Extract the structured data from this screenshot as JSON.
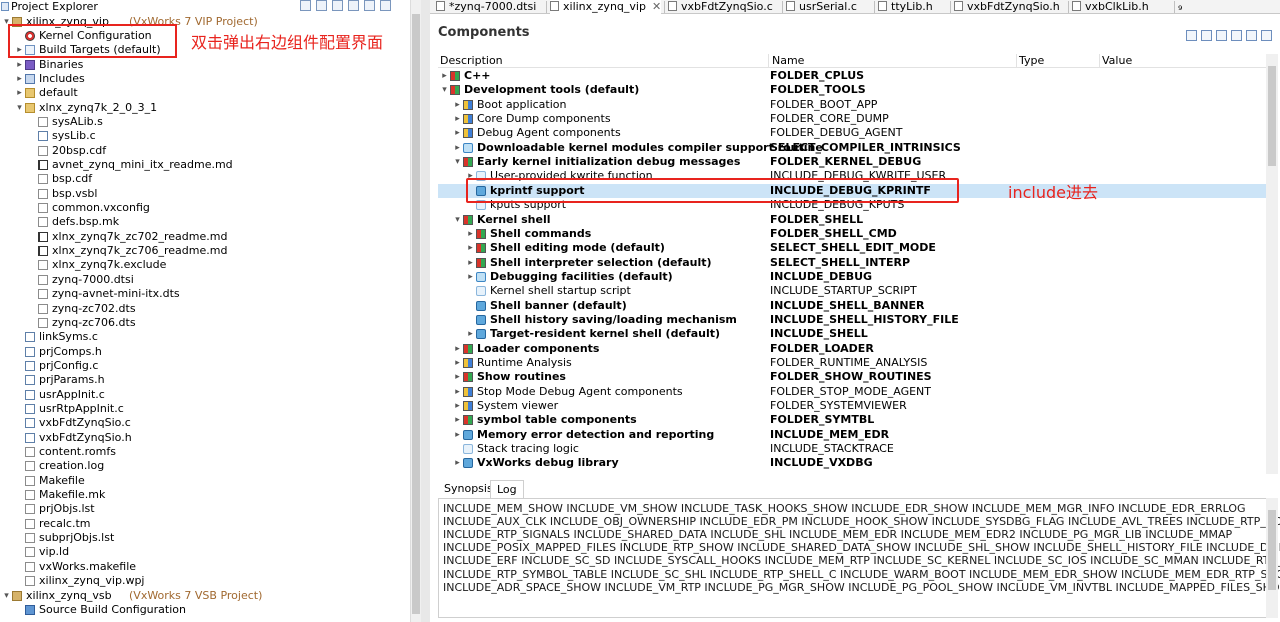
{
  "explorer": {
    "title": "Project Explorer",
    "tree": [
      {
        "label": "xilinx_zynq_vip",
        "decoration": "(VxWorks 7 VIP Project)",
        "icon": "project-icon",
        "level": 0,
        "twisty": "open"
      },
      {
        "label": "Kernel Configuration",
        "icon": "kernel-config-icon",
        "level": 1
      },
      {
        "label": "Build Targets (default)",
        "icon": "build-targets-icon",
        "level": 1,
        "twisty": "closed"
      },
      {
        "label": "Binaries",
        "icon": "binaries-icon",
        "level": 1,
        "twisty": "closed"
      },
      {
        "label": "Includes",
        "icon": "includes-icon",
        "level": 1,
        "twisty": "closed"
      },
      {
        "label": "default",
        "icon": "folder-icon",
        "level": 1,
        "twisty": "closed"
      },
      {
        "label": "xlnx_zynq7k_2_0_3_1",
        "icon": "folder-icon",
        "level": 1,
        "twisty": "open"
      },
      {
        "label": "sysALib.s",
        "icon": "file-icon",
        "level": 2
      },
      {
        "label": "sysLib.c",
        "icon": "c-file-icon",
        "level": 2
      },
      {
        "label": "20bsp.cdf",
        "icon": "file-icon",
        "level": 2
      },
      {
        "label": "avnet_zynq_mini_itx_readme.md",
        "icon": "markdown-icon",
        "level": 2
      },
      {
        "label": "bsp.cdf",
        "icon": "file-icon",
        "level": 2
      },
      {
        "label": "bsp.vsbl",
        "icon": "file-icon",
        "level": 2
      },
      {
        "label": "common.vxconfig",
        "icon": "file-icon",
        "level": 2
      },
      {
        "label": "defs.bsp.mk",
        "icon": "file-icon",
        "level": 2
      },
      {
        "label": "xlnx_zynq7k_zc702_readme.md",
        "icon": "markdown-icon",
        "level": 2
      },
      {
        "label": "xlnx_zynq7k_zc706_readme.md",
        "icon": "markdown-icon",
        "level": 2
      },
      {
        "label": "xlnx_zynq7k.exclude",
        "icon": "file-icon",
        "level": 2
      },
      {
        "label": "zynq-7000.dtsi",
        "icon": "file-icon",
        "level": 2
      },
      {
        "label": "zynq-avnet-mini-itx.dts",
        "icon": "file-icon",
        "level": 2
      },
      {
        "label": "zynq-zc702.dts",
        "icon": "file-icon",
        "level": 2
      },
      {
        "label": "zynq-zc706.dts",
        "icon": "file-icon",
        "level": 2
      },
      {
        "label": "linkSyms.c",
        "icon": "c-file-icon",
        "level": 1
      },
      {
        "label": "prjComps.h",
        "icon": "h-file-icon",
        "level": 1
      },
      {
        "label": "prjConfig.c",
        "icon": "c-file-icon",
        "level": 1
      },
      {
        "label": "prjParams.h",
        "icon": "h-file-icon",
        "level": 1
      },
      {
        "label": "usrAppInit.c",
        "icon": "c-file-icon",
        "level": 1
      },
      {
        "label": "usrRtpAppInit.c",
        "icon": "c-file-icon",
        "level": 1
      },
      {
        "label": "vxbFdtZynqSio.c",
        "icon": "c-file-icon",
        "level": 1
      },
      {
        "label": "vxbFdtZynqSio.h",
        "icon": "h-file-icon",
        "level": 1
      },
      {
        "label": "content.romfs",
        "icon": "file-icon",
        "level": 1
      },
      {
        "label": "creation.log",
        "icon": "file-icon",
        "level": 1
      },
      {
        "label": "Makefile",
        "icon": "file-icon",
        "level": 1
      },
      {
        "label": "Makefile.mk",
        "icon": "file-icon",
        "level": 1
      },
      {
        "label": "prjObjs.lst",
        "icon": "file-icon",
        "level": 1
      },
      {
        "label": "recalc.tm",
        "icon": "file-icon",
        "level": 1
      },
      {
        "label": "subprjObjs.lst",
        "icon": "file-icon",
        "level": 1
      },
      {
        "label": "vip.ld",
        "icon": "file-icon",
        "level": 1
      },
      {
        "label": "vxWorks.makefile",
        "icon": "file-icon",
        "level": 1
      },
      {
        "label": "xilinx_zynq_vip.wpj",
        "icon": "file-icon",
        "level": 1
      },
      {
        "label": "xilinx_zynq_vsb",
        "decoration": "(VxWorks 7 VSB Project)",
        "icon": "project-icon",
        "level": 0,
        "twisty": "open"
      },
      {
        "label": "Source Build Configuration",
        "icon": "source-build-icon",
        "level": 1
      }
    ]
  },
  "annotation_left": "双击弹出右边组件配置界面",
  "annotation_right": "include进去",
  "editor_tabs": [
    {
      "label": "*zynq-7000.dtsi",
      "active": false
    },
    {
      "label": "xilinx_zynq_vip",
      "active": true
    },
    {
      "label": "vxbFdtZynqSio.c",
      "active": false
    },
    {
      "label": "usrSerial.c",
      "active": false
    },
    {
      "label": "ttyLib.h",
      "active": false
    },
    {
      "label": "vxbFdtZynqSio.h",
      "active": false
    },
    {
      "label": "vxbClkLib.h",
      "active": false
    },
    {
      "label": "₉",
      "active": false
    }
  ],
  "components": {
    "title": "Components",
    "columns": {
      "description": "Description",
      "name": "Name",
      "type": "Type",
      "value": "Value"
    },
    "rows": [
      {
        "desc": "C++",
        "name": "FOLDER_CPLUS",
        "bold": true,
        "level": 0,
        "twisty": "closed",
        "icon": "folder"
      },
      {
        "desc": "Development tools (default)",
        "name": "FOLDER_TOOLS",
        "bold": true,
        "level": 0,
        "twisty": "open",
        "icon": "folder"
      },
      {
        "desc": "Boot application",
        "name": "FOLDER_BOOT_APP",
        "bold": false,
        "level": 1,
        "twisty": "closed",
        "icon": "folder2"
      },
      {
        "desc": "Core Dump components",
        "name": "FOLDER_CORE_DUMP",
        "bold": false,
        "level": 1,
        "twisty": "closed",
        "icon": "folder2"
      },
      {
        "desc": "Debug Agent components",
        "name": "FOLDER_DEBUG_AGENT",
        "bold": false,
        "level": 1,
        "twisty": "closed",
        "icon": "folder2"
      },
      {
        "desc": "Downloadable kernel modules compiler support routine",
        "name": "SELECT_COMPILER_INTRINSICS",
        "bold": true,
        "level": 1,
        "twisty": "closed",
        "icon": "comp"
      },
      {
        "desc": "Early kernel initialization debug messages",
        "name": "FOLDER_KERNEL_DEBUG",
        "bold": true,
        "level": 1,
        "twisty": "open",
        "icon": "folder"
      },
      {
        "desc": "User-provided kwrite function",
        "name": "INCLUDE_DEBUG_KWRITE_USER",
        "bold": false,
        "level": 2,
        "twisty": "closed",
        "icon": "param"
      },
      {
        "desc": "kprintf support",
        "name": "INCLUDE_DEBUG_KPRINTF",
        "bold": true,
        "level": 2,
        "twisty": "",
        "icon": "sel",
        "selected": true
      },
      {
        "desc": "kputs support",
        "name": "INCLUDE_DEBUG_KPUTS",
        "bold": false,
        "level": 2,
        "twisty": "",
        "icon": "param"
      },
      {
        "desc": "Kernel shell",
        "name": "FOLDER_SHELL",
        "bold": true,
        "level": 1,
        "twisty": "open",
        "icon": "folder"
      },
      {
        "desc": "Shell commands",
        "name": "FOLDER_SHELL_CMD",
        "bold": true,
        "level": 2,
        "twisty": "closed",
        "icon": "folder"
      },
      {
        "desc": "Shell editing mode (default)",
        "name": "SELECT_SHELL_EDIT_MODE",
        "bold": true,
        "level": 2,
        "twisty": "closed",
        "icon": "folder"
      },
      {
        "desc": "Shell interpreter selection (default)",
        "name": "SELECT_SHELL_INTERP",
        "bold": true,
        "level": 2,
        "twisty": "closed",
        "icon": "folder"
      },
      {
        "desc": "Debugging facilities (default)",
        "name": "INCLUDE_DEBUG",
        "bold": true,
        "level": 2,
        "twisty": "closed",
        "icon": "comp"
      },
      {
        "desc": "Kernel shell startup script",
        "name": "INCLUDE_STARTUP_SCRIPT",
        "bold": false,
        "level": 2,
        "twisty": "",
        "icon": "param"
      },
      {
        "desc": "Shell banner (default)",
        "name": "INCLUDE_SHELL_BANNER",
        "bold": true,
        "level": 2,
        "twisty": "",
        "icon": "sel"
      },
      {
        "desc": "Shell history saving/loading mechanism",
        "name": "INCLUDE_SHELL_HISTORY_FILE",
        "bold": true,
        "level": 2,
        "twisty": "",
        "icon": "sel"
      },
      {
        "desc": "Target-resident kernel shell (default)",
        "name": "INCLUDE_SHELL",
        "bold": true,
        "level": 2,
        "twisty": "closed",
        "icon": "sel"
      },
      {
        "desc": "Loader components",
        "name": "FOLDER_LOADER",
        "bold": true,
        "level": 1,
        "twisty": "closed",
        "icon": "folder"
      },
      {
        "desc": "Runtime Analysis",
        "name": "FOLDER_RUNTIME_ANALYSIS",
        "bold": false,
        "level": 1,
        "twisty": "closed",
        "icon": "folder2"
      },
      {
        "desc": "Show routines",
        "name": "FOLDER_SHOW_ROUTINES",
        "bold": true,
        "level": 1,
        "twisty": "closed",
        "icon": "folder"
      },
      {
        "desc": "Stop Mode Debug Agent components",
        "name": "FOLDER_STOP_MODE_AGENT",
        "bold": false,
        "level": 1,
        "twisty": "closed",
        "icon": "folder2"
      },
      {
        "desc": "System viewer",
        "name": "FOLDER_SYSTEMVIEWER",
        "bold": false,
        "level": 1,
        "twisty": "closed",
        "icon": "folder2"
      },
      {
        "desc": "symbol table components",
        "name": "FOLDER_SYMTBL",
        "bold": true,
        "level": 1,
        "twisty": "closed",
        "icon": "folder"
      },
      {
        "desc": "Memory error detection and reporting",
        "name": "INCLUDE_MEM_EDR",
        "bold": true,
        "level": 1,
        "twisty": "closed",
        "icon": "sel"
      },
      {
        "desc": "Stack tracing logic",
        "name": "INCLUDE_STACKTRACE",
        "bold": false,
        "level": 1,
        "twisty": "",
        "icon": "param"
      },
      {
        "desc": "VxWorks debug library",
        "name": "INCLUDE_VXDBG",
        "bold": true,
        "level": 1,
        "twisty": "closed",
        "icon": "sel"
      }
    ]
  },
  "lower": {
    "tabs": [
      "Synopsis",
      "Log"
    ],
    "active": "Log",
    "lines": [
      "INCLUDE_MEM_SHOW INCLUDE_VM_SHOW INCLUDE_TASK_HOOKS_SHOW INCLUDE_EDR_SHOW INCLUDE_MEM_MGR_INFO INCLUDE_EDR_ERRLOG",
      "INCLUDE_AUX_CLK INCLUDE_OBJ_OWNERSHIP INCLUDE_EDR_PM INCLUDE_HOOK_SHOW INCLUDE_SYSDBG_FLAG INCLUDE_AVL_TREES INCLUDE_RTP_HOOKS",
      "INCLUDE_RTP_SIGNALS INCLUDE_SHARED_DATA INCLUDE_SHL INCLUDE_MEM_EDR INCLUDE_MEM_EDR2 INCLUDE_PG_MGR_LIB INCLUDE_MMAP",
      "INCLUDE_POSIX_MAPPED_FILES INCLUDE_RTP_SHOW INCLUDE_SHARED_DATA_SHOW INCLUDE_SHL_SHOW INCLUDE_SHELL_HISTORY_FILE INCLUDE_DISK_UTIL",
      "INCLUDE_ERF INCLUDE_SC_SD INCLUDE_SYSCALL_HOOKS INCLUDE_MEM_RTP INCLUDE_SC_KERNEL INCLUDE_SC_IOS INCLUDE_SC_MMAN INCLUDE_RTP_ARCH",
      "INCLUDE_RTP_SYMBOL_TABLE INCLUDE_SC_SHL INCLUDE_RTP_SHELL_C INCLUDE_WARM_BOOT INCLUDE_MEM_EDR_SHOW INCLUDE_MEM_EDR_RTP_SHOW",
      "INCLUDE_ADR_SPACE_SHOW INCLUDE_VM_RTP INCLUDE_PG_MGR_SHOW INCLUDE_PG_POOL_SHOW INCLUDE_VM_INVTBL INCLUDE_MAPPED_FILES_SHOW"
    ]
  }
}
